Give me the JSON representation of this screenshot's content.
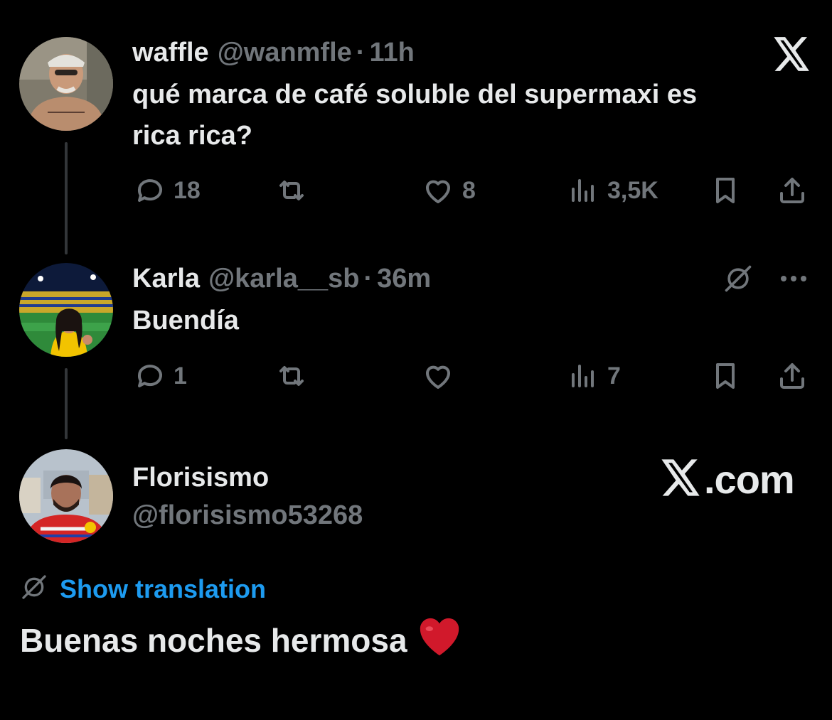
{
  "tweets": [
    {
      "name": "waffle",
      "handle": "@wanmfle",
      "time": "11h",
      "text_line1": "qué marca de café soluble del supermaxi es",
      "text_line2": "rica rica?",
      "replies": "18",
      "retweets": "",
      "likes": "8",
      "views": "3,5K"
    },
    {
      "name": "Karla",
      "handle": "@karla__sb",
      "time": "36m",
      "text": "Buendía",
      "replies": "1",
      "retweets": "",
      "likes": "",
      "views": "7"
    }
  ],
  "reply": {
    "name": "Florisismo",
    "handle": "@florisismo53268",
    "show_translation": "Show translation",
    "text": "Buenas noches hermosa"
  },
  "branding": {
    "site": ".com"
  },
  "colors": {
    "background": "#000000",
    "text": "#e7e9ea",
    "muted": "#71767b",
    "accent": "#1d9bf0",
    "heart": "#d1192b"
  },
  "icons": [
    "reply-icon",
    "retweet-icon",
    "like-icon",
    "views-icon",
    "bookmark-icon",
    "share-icon",
    "x-logo-icon",
    "translate-icon",
    "more-icon"
  ]
}
